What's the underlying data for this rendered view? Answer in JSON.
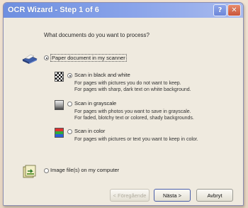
{
  "window": {
    "title": "OCR Wizard - Step 1 of 6",
    "help_glyph": "?",
    "close_glyph": "✕"
  },
  "question": "What documents do you want to process?",
  "options": {
    "paper": {
      "label": "Paper document in my scanner",
      "selected": true,
      "icon": "scanner-icon"
    },
    "bw": {
      "label": "Scan in black and white",
      "selected": true,
      "icon": "checkerboard-icon",
      "desc1": "For pages with pictures you do not want to keep.",
      "desc2": "For pages with sharp, dark text on white background."
    },
    "gray": {
      "label": "Scan in grayscale",
      "selected": false,
      "icon": "grayscale-icon",
      "desc1": "For pages with photos you want to save in grayscale.",
      "desc2": "For faded, blotchy text or colored, shady backgrounds."
    },
    "color": {
      "label": "Scan in color",
      "selected": false,
      "icon": "color-icon",
      "desc1": "For pages with pictures or text you want to keep in color."
    },
    "image": {
      "label": "Image file(s) on my computer",
      "selected": false,
      "icon": "image-file-icon"
    }
  },
  "buttons": {
    "back": "< Föregående",
    "next": "Nästa >",
    "cancel": "Avbryt"
  }
}
